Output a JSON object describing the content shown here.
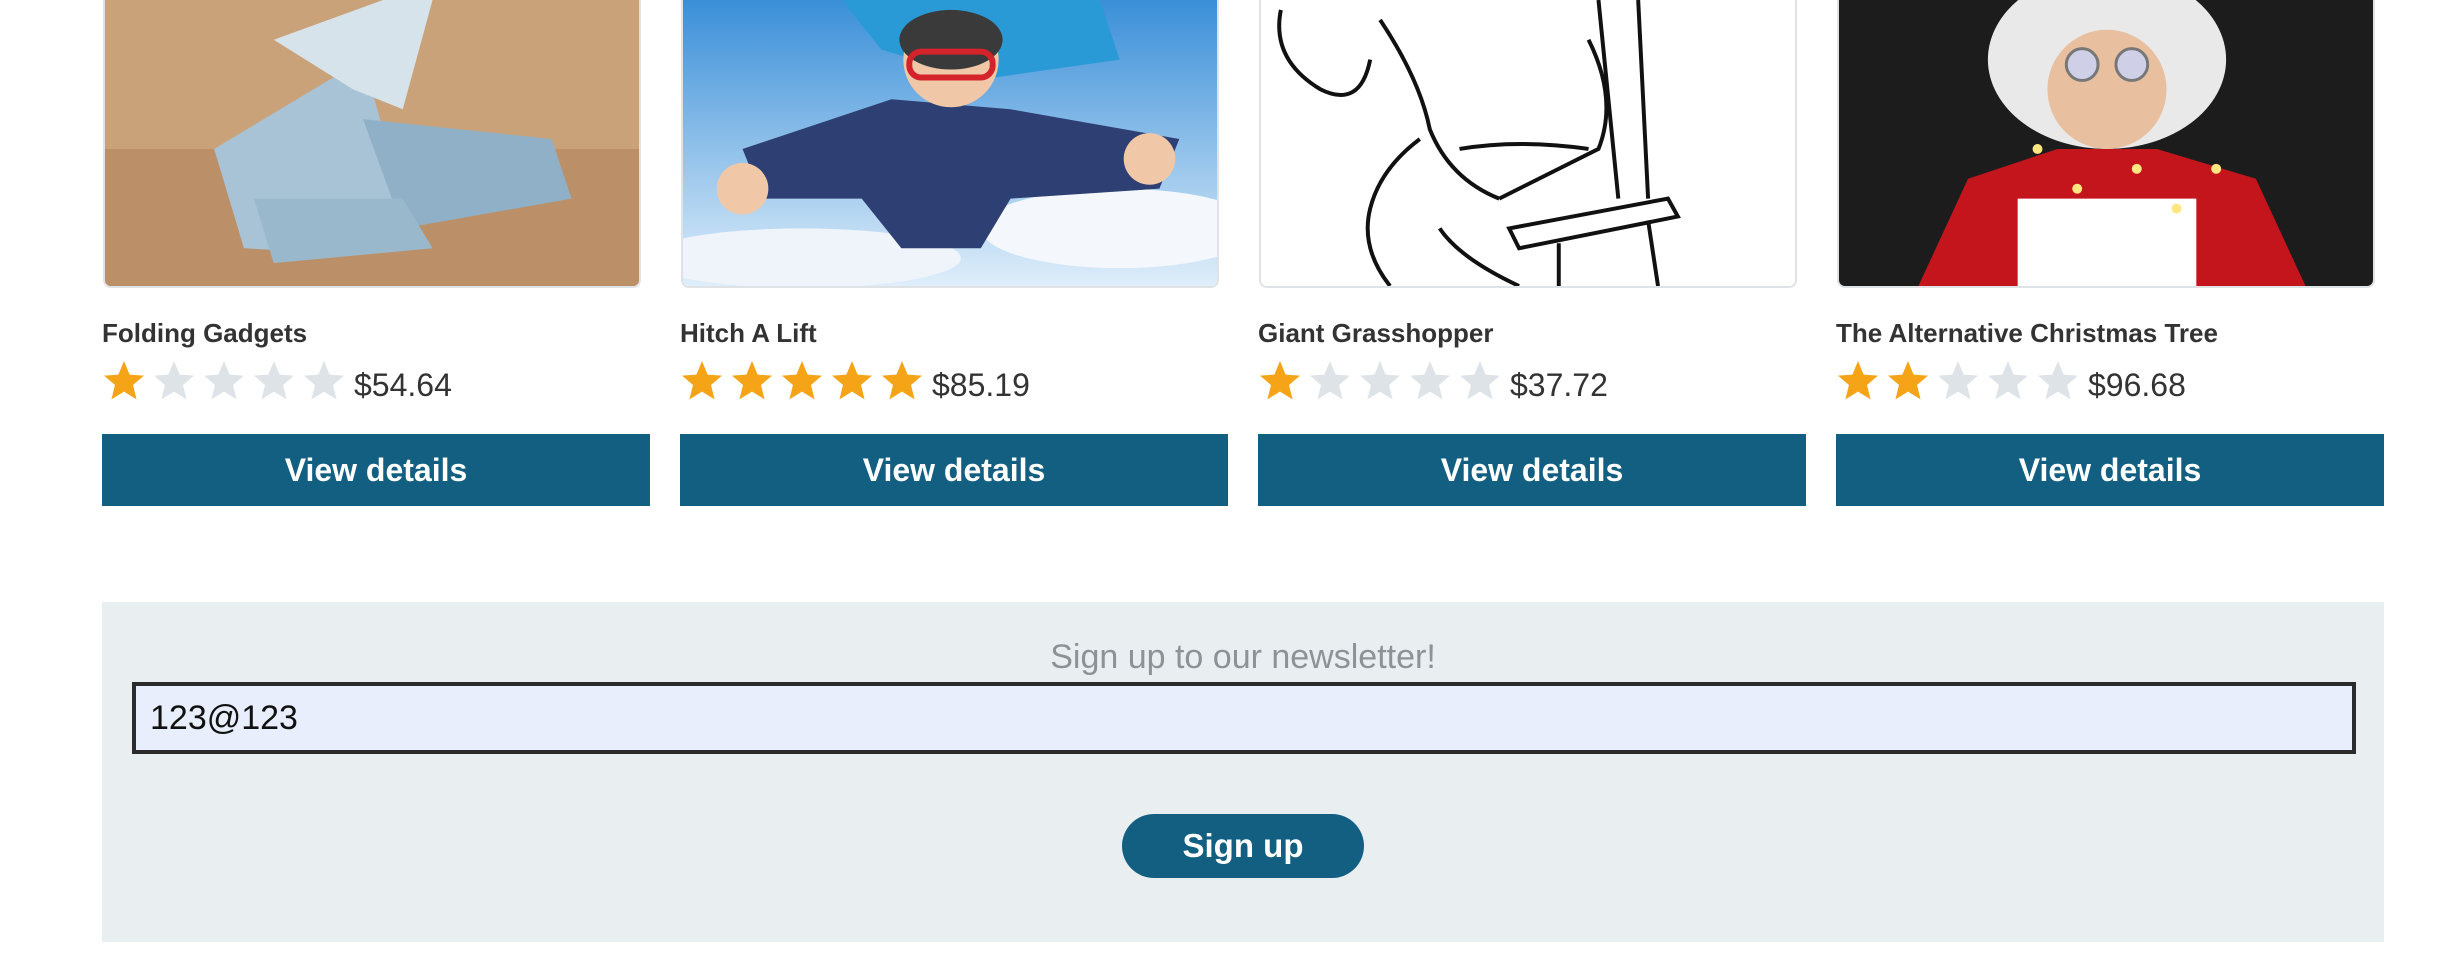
{
  "products": [
    {
      "name": "Folding Gadgets",
      "rating": 1,
      "max_rating": 5,
      "price": "$54.64",
      "button_label": "View details",
      "image": "origami-bird-photo"
    },
    {
      "name": "Hitch A Lift",
      "rating": 5,
      "max_rating": 5,
      "price": "$85.19",
      "button_label": "View details",
      "image": "tandem-skydivers-photo"
    },
    {
      "name": "Giant Grasshopper",
      "rating": 1,
      "max_rating": 5,
      "price": "$37.72",
      "button_label": "View details",
      "image": "sketch-figure-on-stool"
    },
    {
      "name": "The Alternative Christmas Tree",
      "rating": 2,
      "max_rating": 5,
      "price": "$96.68",
      "button_label": "View details",
      "image": "santa-with-lights-photo"
    }
  ],
  "newsletter": {
    "title": "Sign up to our newsletter!",
    "email_value": "123@123",
    "button_label": "Sign up"
  },
  "colors": {
    "primary": "#125f82",
    "star_filled": "#f5a417",
    "star_empty": "#dde3e7",
    "newsletter_bg": "#e9eef1"
  }
}
